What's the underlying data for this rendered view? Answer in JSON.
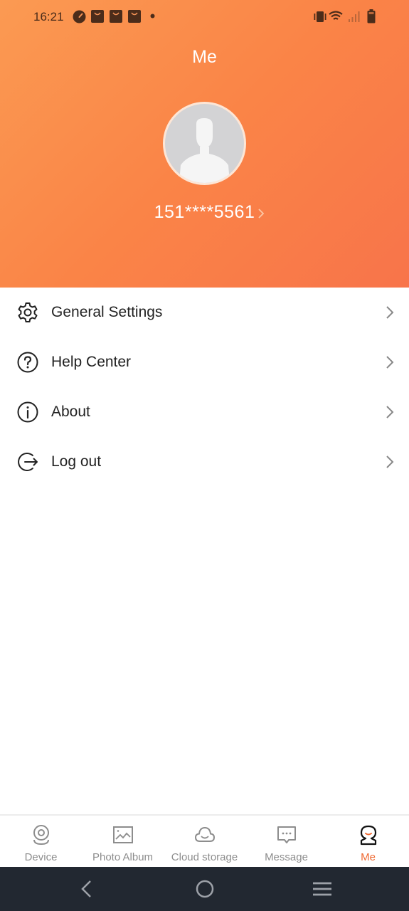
{
  "status_bar": {
    "time": "16:21",
    "left_icons": [
      "speedometer-icon",
      "shopping-bag-icon",
      "shopping-bag-icon",
      "shopping-bag-icon",
      "dot-icon"
    ],
    "right_icons": [
      "vibrate-icon",
      "wifi-icon",
      "signal-icon",
      "battery-icon"
    ]
  },
  "header": {
    "title": "Me",
    "phone": "151****5561",
    "gradient_start": "#fb9a52",
    "gradient_end": "#f8744a"
  },
  "menu": {
    "items": [
      {
        "label": "General Settings",
        "icon": "gear-icon"
      },
      {
        "label": "Help Center",
        "icon": "help-circle-icon"
      },
      {
        "label": "About",
        "icon": "info-circle-icon"
      },
      {
        "label": "Log out",
        "icon": "logout-icon"
      }
    ]
  },
  "tabbar": {
    "accent": "#ef6a32",
    "active": "Me",
    "tabs": [
      {
        "label": "Device",
        "icon": "camera-device-icon"
      },
      {
        "label": "Photo Album",
        "icon": "photo-album-icon"
      },
      {
        "label": "Cloud storage",
        "icon": "cloud-icon"
      },
      {
        "label": "Message",
        "icon": "message-icon"
      },
      {
        "label": "Me",
        "icon": "user-icon"
      }
    ]
  },
  "system_nav": {
    "buttons": [
      "back-icon",
      "home-icon",
      "menu-icon"
    ]
  }
}
